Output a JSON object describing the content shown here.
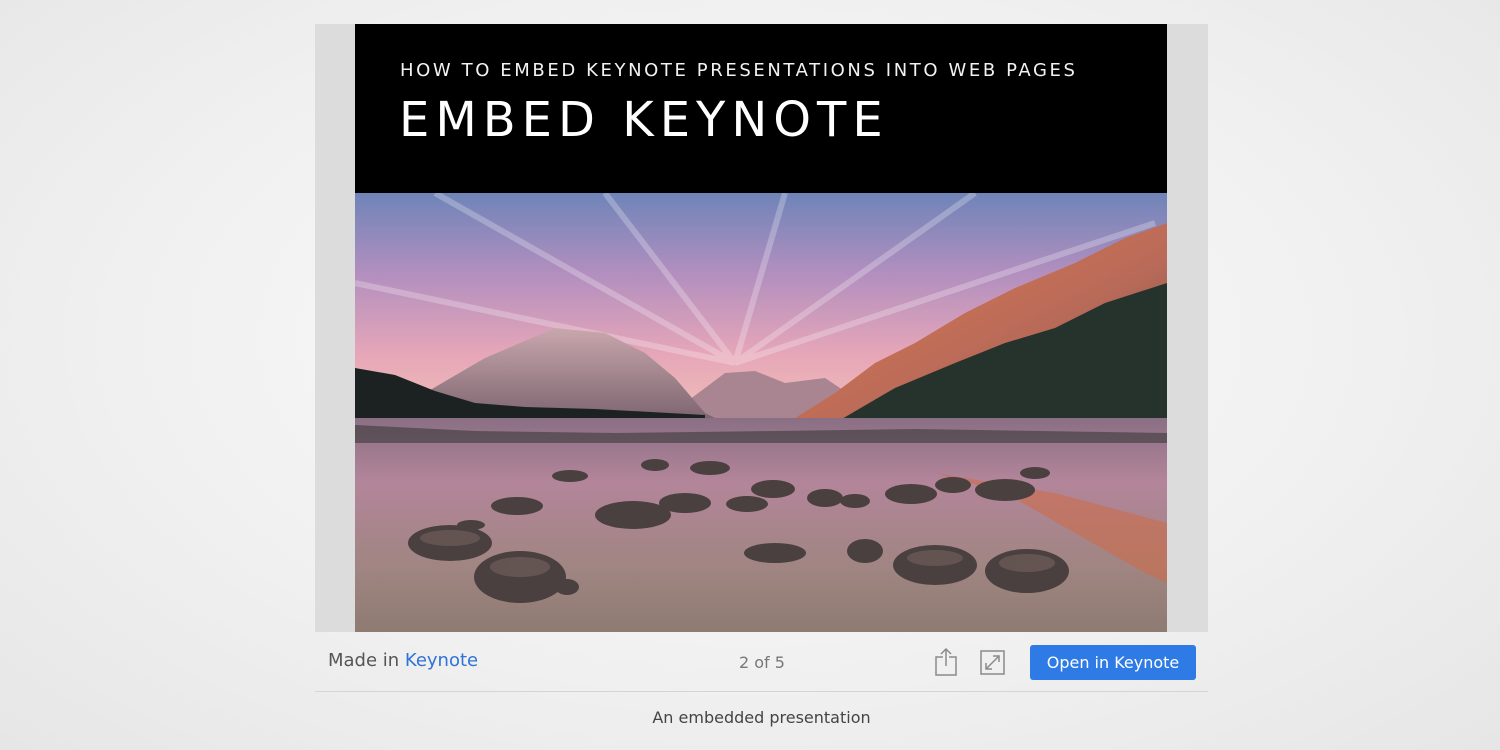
{
  "slide": {
    "subtitle": "HOW TO EMBED KEYNOTE PRESENTATIONS INTO WEB PAGES",
    "title": "EMBED KEYNOTE"
  },
  "toolbar": {
    "made_in_prefix": "Made in ",
    "made_in_brand": "Keynote",
    "page_counter": "2 of 5",
    "share_icon": "share-icon",
    "fullscreen_icon": "fullscreen-icon",
    "open_button_label": "Open in Keynote"
  },
  "caption": "An embedded presentation",
  "colors": {
    "accent": "#2e7be6",
    "brand_link": "#2f73d8",
    "slide_header_bg": "#000000"
  }
}
